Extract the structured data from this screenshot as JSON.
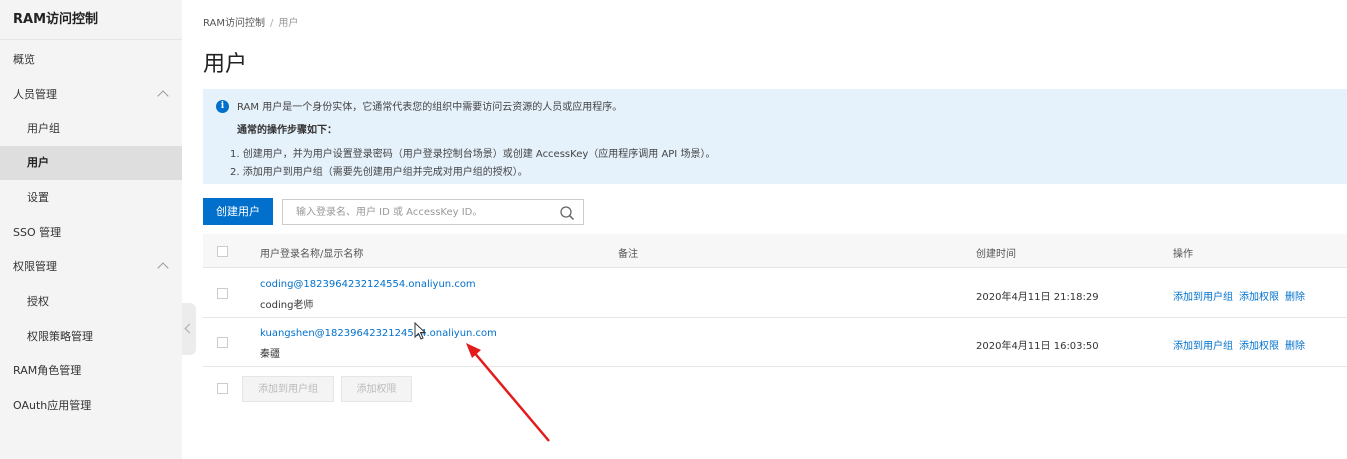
{
  "sidebar": {
    "title": "RAM访问控制",
    "items": [
      {
        "label": "概览"
      },
      {
        "label": "人员管理"
      },
      {
        "label": "用户组"
      },
      {
        "label": "用户"
      },
      {
        "label": "设置"
      },
      {
        "label": "SSO 管理"
      },
      {
        "label": "权限管理"
      },
      {
        "label": "授权"
      },
      {
        "label": "权限策略管理"
      },
      {
        "label": "RAM角色管理"
      },
      {
        "label": "OAuth应用管理"
      }
    ],
    "active_item": "用户"
  },
  "breadcrumb": {
    "root": "RAM访问控制",
    "separator": "/",
    "current": "用户"
  },
  "page_title": "用户",
  "info": {
    "line1": "RAM 用户是一个身份实体，它通常代表您的组织中需要访问云资源的人员或应用程序。",
    "heading": "通常的操作步骤如下：",
    "step1": "1. 创建用户，并为用户设置登录密码（用户登录控制台场景）或创建 AccessKey（应用程序调用 API 场景）。",
    "step2": "2. 添加用户到用户组（需要先创建用户组并完成对用户组的授权）。"
  },
  "toolbar": {
    "create_label": "创建用户",
    "search_placeholder": "输入登录名、用户 ID 或 AccessKey ID。"
  },
  "table": {
    "columns": [
      "用户登录名称/显示名称",
      "备注",
      "创建时间",
      "操作"
    ],
    "rows": [
      {
        "login": "coding@1823964232124554.onaliyun.com",
        "display": "coding老师",
        "note": "",
        "created": "2020年4月11日 21:18:29",
        "actions": [
          "添加到用户组",
          "添加权限",
          "删除"
        ]
      },
      {
        "login": "kuangshen@1823964232124554.onaliyun.com",
        "display": "秦疆",
        "note": "",
        "created": "2020年4月11日 16:03:50",
        "actions": [
          "添加到用户组",
          "添加权限",
          "删除"
        ]
      }
    ]
  },
  "footer": {
    "add_group_label": "添加到用户组",
    "add_perm_label": "添加权限"
  },
  "colors": {
    "accent": "#0070cc",
    "info_bg": "#e5f1fb",
    "sidebar_bg": "#f4f4f4",
    "annotation_arrow": "#e31b1b"
  }
}
